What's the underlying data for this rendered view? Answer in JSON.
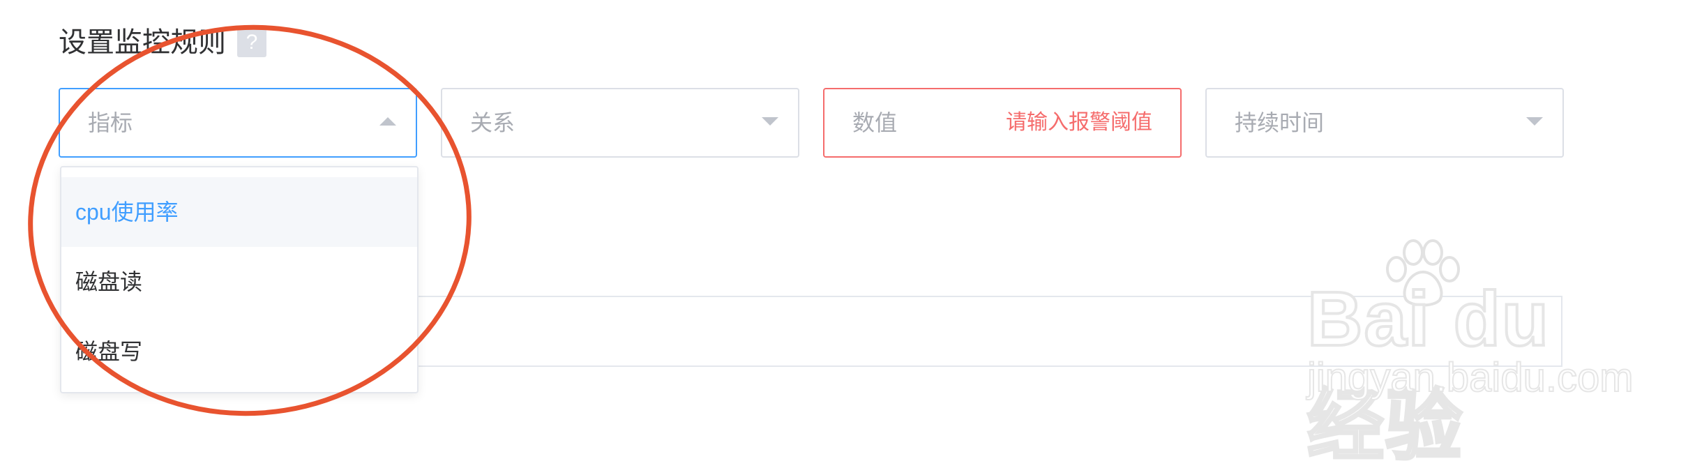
{
  "section": {
    "title": "设置监控规则",
    "help_icon": "?"
  },
  "fields": {
    "metric": {
      "placeholder": "指标",
      "state": "open"
    },
    "relation": {
      "placeholder": "关系"
    },
    "value": {
      "placeholder": "数值",
      "error": "请输入报警阈值"
    },
    "duration": {
      "placeholder": "持续时间"
    }
  },
  "metric_options": [
    {
      "label": "cpu使用率",
      "hovered": true
    },
    {
      "label": "磁盘读"
    },
    {
      "label": "磁盘写"
    }
  ],
  "colors": {
    "accent": "#409eff",
    "error": "#f56c6c",
    "annotation_circle": "#e8532f"
  },
  "watermark": {
    "brand": "Bai du 经验",
    "domain": "jingyan.baidu.com"
  }
}
